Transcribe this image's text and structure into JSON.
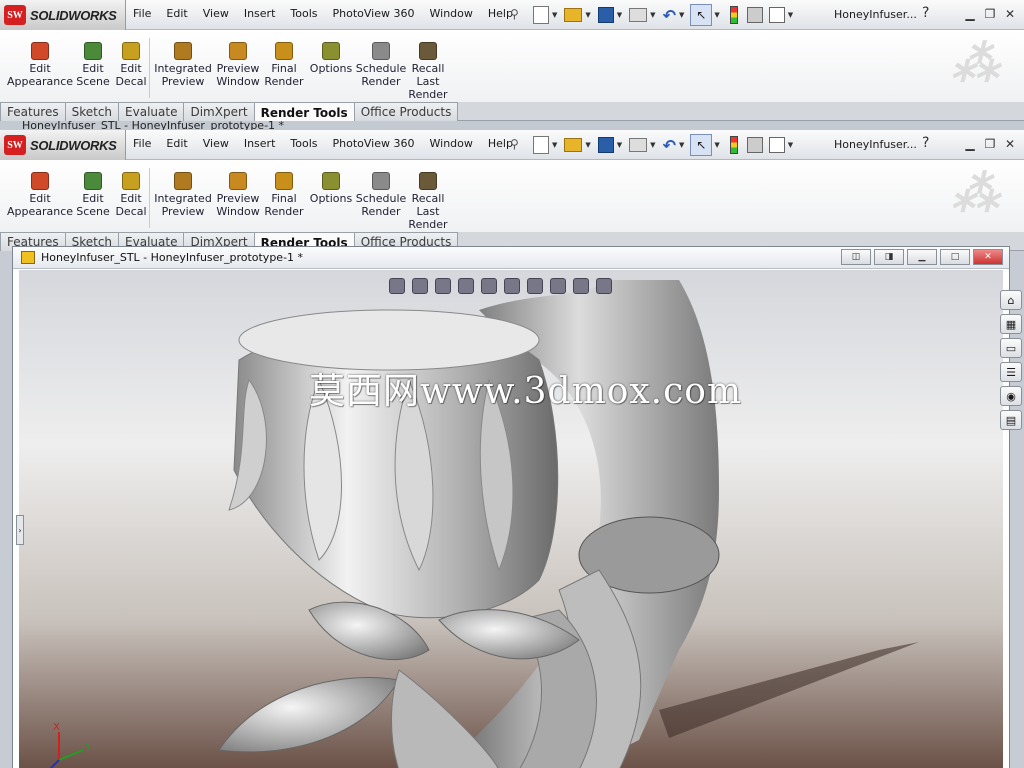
{
  "app": {
    "brand": "SOLIDWORKS",
    "brand_mark": "SW"
  },
  "menu": [
    "File",
    "Edit",
    "View",
    "Insert",
    "Tools",
    "PhotoView 360",
    "Window",
    "Help"
  ],
  "title": {
    "filename": "HoneyInfuser...",
    "help": "?"
  },
  "ribbon": {
    "buttons": [
      {
        "label": "Edit\nAppearance",
        "icon": "edit-appearance-icon",
        "color": "#d04a2a"
      },
      {
        "label": "Edit\nScene",
        "icon": "edit-scene-icon",
        "color": "#4a8a3a"
      },
      {
        "label": "Edit\nDecal",
        "icon": "edit-decal-icon",
        "color": "#c8a020"
      },
      {
        "label": "Integrated\nPreview",
        "icon": "integrated-preview-icon",
        "color": "#b07a20"
      },
      {
        "label": "Preview\nWindow",
        "icon": "preview-window-icon",
        "color": "#c88a20"
      },
      {
        "label": "Final\nRender",
        "icon": "final-render-icon",
        "color": "#c8901a"
      },
      {
        "label": "Options",
        "icon": "options-icon",
        "color": "#8a9030"
      },
      {
        "label": "Schedule\nRender",
        "icon": "schedule-render-icon",
        "color": "#8a8a8a"
      },
      {
        "label": "Recall\nLast\nRender",
        "icon": "recall-render-icon",
        "color": "#6a5a3a"
      }
    ]
  },
  "tabs": [
    "Features",
    "Sketch",
    "Evaluate",
    "DimXpert",
    "Render Tools",
    "Office Products"
  ],
  "active_tab": "Render Tools",
  "document": {
    "title": "HoneyInfuser_STL - HoneyInfuser_prototype-1 *"
  },
  "watermark": "莫西网www.3dmox.com",
  "triad": {
    "x": "X",
    "y": "Y",
    "z": "Z"
  },
  "colors": {
    "accent": "#d42020",
    "close": "#c33"
  }
}
